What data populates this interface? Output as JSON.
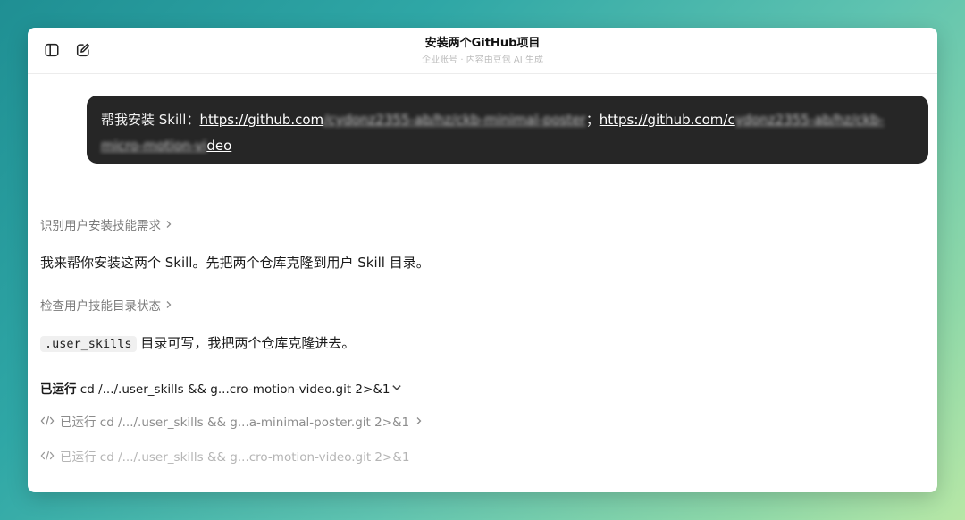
{
  "header": {
    "title": "安装两个GitHub项目",
    "subtitle": "企业账号 · 内容由豆包 AI 生成"
  },
  "user_message": {
    "prefix": "帮我安装 Skill：",
    "link1_visible": "https://github.com",
    "link1_blurred": "/cydonz2355-ab/hz/ckb-minimal-poster",
    "separator": "；",
    "link2_visible": "https://github.com/c",
    "link2_blurred": "ydonz2355-ab/hz/ckb-micro-motion-vi",
    "link2_tail": "deo"
  },
  "thoughts": [
    {
      "label": "识别用户安装技能需求"
    },
    {
      "label": "检查用户技能目录状态"
    }
  ],
  "replies": [
    {
      "text": "我来帮你安装这两个 Skill。先把两个仓库克隆到用户 Skill 目录。"
    },
    {
      "code": ".user_skills",
      "text": " 目录可写，我把两个仓库克隆进去。"
    }
  ],
  "runs": [
    {
      "prefix": "已运行",
      "command": " cd /.../.user_skills && g...cro-motion-video.git 2>&1"
    },
    {
      "prefix": "已运行",
      "command": " cd /.../.user_skills && g...a-minimal-poster.git 2>&1"
    },
    {
      "prefix": "已运行",
      "command": " cd /.../.user_skills && g...cro-motion-video.git 2>&1"
    }
  ]
}
